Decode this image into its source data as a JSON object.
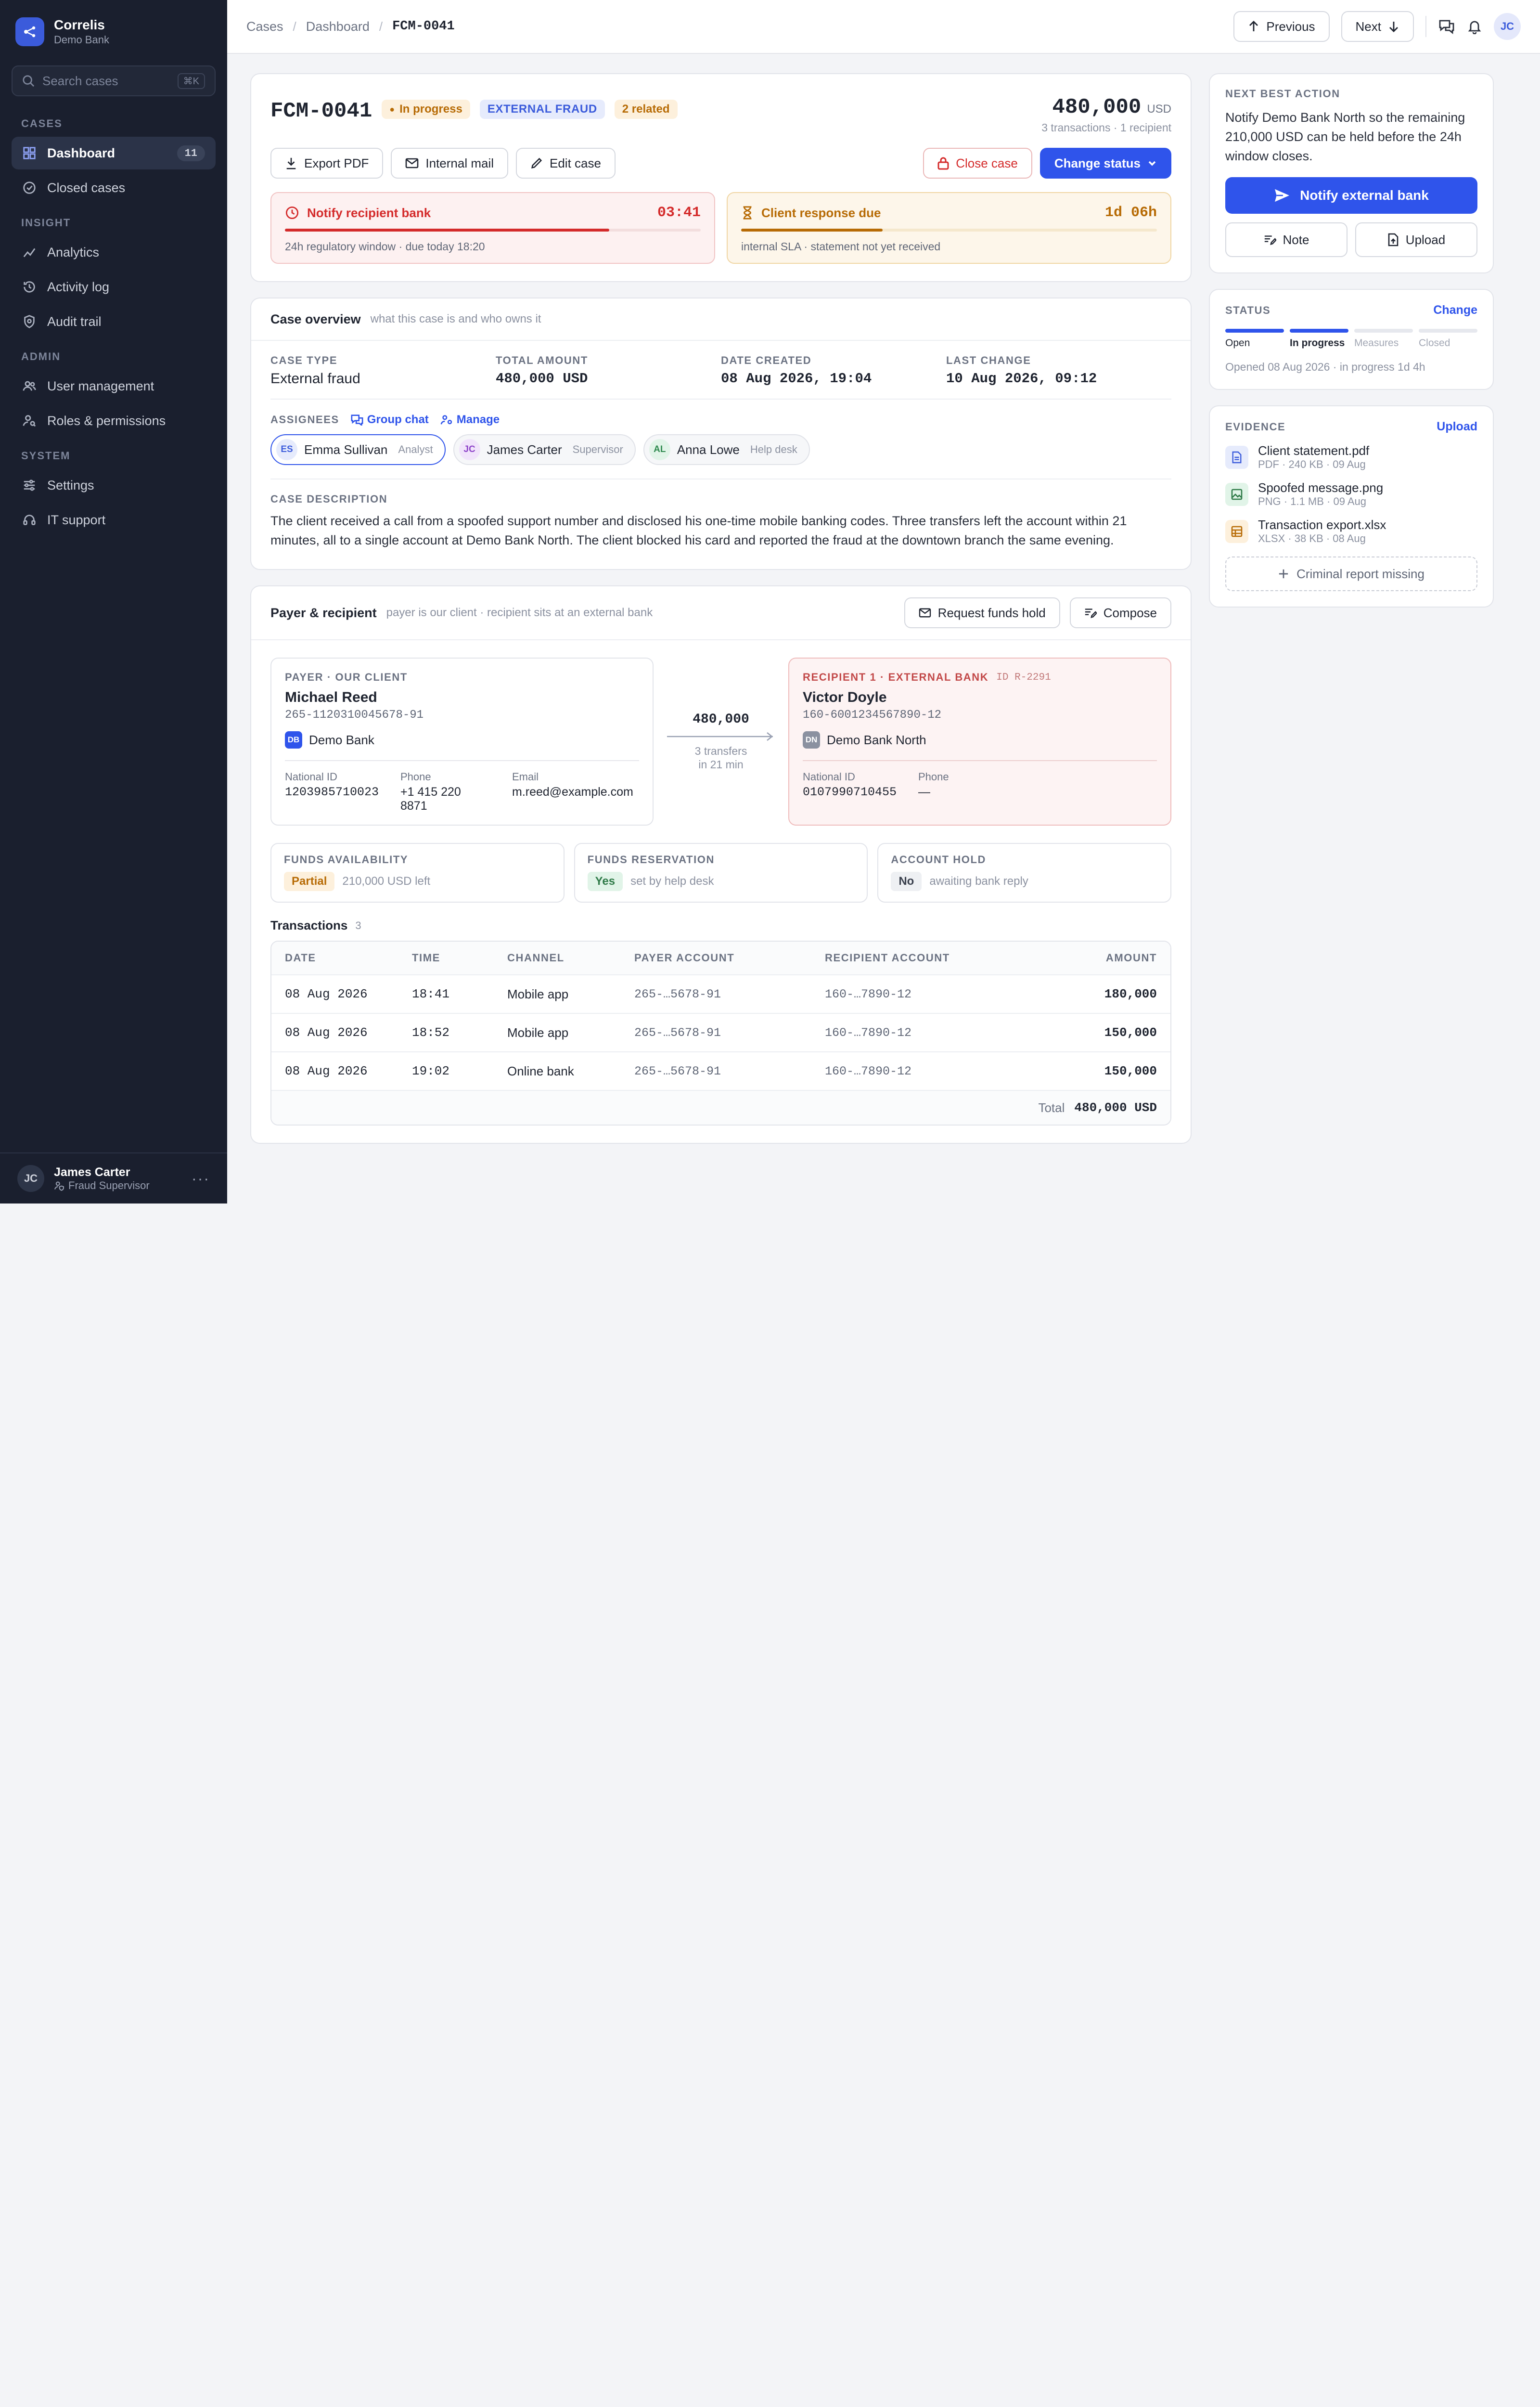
{
  "brand": {
    "name": "Correlis",
    "sub": "Demo Bank"
  },
  "search": {
    "placeholder": "Search cases",
    "shortcut": "⌘K"
  },
  "nav": {
    "cases_label": "CASES",
    "dashboard": "Dashboard",
    "dashboard_count": "11",
    "closed": "Closed cases",
    "insight_label": "INSIGHT",
    "analytics": "Analytics",
    "activity": "Activity log",
    "audit": "Audit trail",
    "admin_label": "ADMIN",
    "users": "User management",
    "roles": "Roles & permissions",
    "system_label": "SYSTEM",
    "settings": "Settings",
    "support": "IT support"
  },
  "user": {
    "initials": "JC",
    "name": "James Carter",
    "role": "Fraud Supervisor"
  },
  "breadcrumb": {
    "root": "Cases",
    "mid": "Dashboard",
    "current": "FCM-0041"
  },
  "topbar": {
    "previous": "Previous",
    "next": "Next",
    "avatar": "JC"
  },
  "case": {
    "id": "FCM-0041",
    "status_pill": "In progress",
    "type_pill": "EXTERNAL FRAUD",
    "related_pill": "2 related",
    "amount": "480,000",
    "currency": "USD",
    "amount_sub": "3 transactions · 1 recipient"
  },
  "actions": {
    "export": "Export PDF",
    "mail": "Internal mail",
    "edit": "Edit case",
    "close": "Close case",
    "change": "Change status"
  },
  "sla": {
    "red": {
      "title": "Notify recipient bank",
      "timer": "03:41",
      "progress": 0.78,
      "sub": "24h regulatory window · due today 18:20"
    },
    "amber": {
      "title": "Client response due",
      "timer": "1d 06h",
      "progress": 0.34,
      "sub": "internal SLA · statement not yet received"
    }
  },
  "overview": {
    "title": "Case overview",
    "sub": "what this case is and who owns it",
    "type_label": "CASE TYPE",
    "type": "External fraud",
    "total_label": "TOTAL AMOUNT",
    "total": "480,000 USD",
    "created_label": "DATE CREATED",
    "created": "08 Aug 2026, 19:04",
    "changed_label": "LAST CHANGE",
    "changed": "10 Aug 2026, 09:12",
    "assignees_label": "ASSIGNEES",
    "group_chat": "Group chat",
    "manage": "Manage",
    "assignees": [
      {
        "initials": "ES",
        "name": "Emma Sullivan",
        "role": "Analyst"
      },
      {
        "initials": "JC",
        "name": "James Carter",
        "role": "Supervisor"
      },
      {
        "initials": "AL",
        "name": "Anna Lowe",
        "role": "Help desk"
      }
    ],
    "desc_label": "CASE DESCRIPTION",
    "description": "The client received a call from a spoofed support number and disclosed his one-time mobile banking codes. Three transfers left the account within 21 minutes, all to a single account at Demo Bank North. The client blocked his card and reported the fraud at the downtown branch the same evening."
  },
  "payer_section": {
    "title": "Payer & recipient",
    "sub": "payer is our client · recipient sits at an external bank",
    "request_hold": "Request funds hold",
    "compose": "Compose"
  },
  "payer": {
    "label": "PAYER · OUR CLIENT",
    "name": "Michael Reed",
    "account": "265-1120310045678-91",
    "bank_code": "DB",
    "bank": "Demo Bank",
    "id_label": "National ID",
    "id": "1203985710023",
    "phone_label": "Phone",
    "phone": "+1 415 220 8871",
    "email_label": "Email",
    "email": "m.reed@example.com"
  },
  "flow": {
    "amount": "480,000",
    "line1": "3 transfers",
    "line2": "in 21 min"
  },
  "recipient": {
    "label": "RECIPIENT 1 · EXTERNAL BANK",
    "ref": "ID R-2291",
    "name": "Victor Doyle",
    "account": "160-6001234567890-12",
    "bank_code": "DN",
    "bank": "Demo Bank North",
    "id_label": "National ID",
    "id": "0107990710455",
    "phone_label": "Phone",
    "phone": "—"
  },
  "stats": {
    "availability": {
      "label": "FUNDS AVAILABILITY",
      "tag": "Partial",
      "note": "210,000 USD left"
    },
    "reservation": {
      "label": "FUNDS RESERVATION",
      "tag": "Yes",
      "note": "set by help desk"
    },
    "hold": {
      "label": "ACCOUNT HOLD",
      "tag": "No",
      "note": "awaiting bank reply"
    }
  },
  "transactions": {
    "title": "Transactions",
    "count": "3",
    "headers": [
      "DATE",
      "TIME",
      "CHANNEL",
      "PAYER ACCOUNT",
      "RECIPIENT ACCOUNT",
      "AMOUNT"
    ],
    "rows": [
      [
        "08 Aug 2026",
        "18:41",
        "Mobile app",
        "265-…5678-91",
        "160-…7890-12",
        "180,000"
      ],
      [
        "08 Aug 2026",
        "18:52",
        "Mobile app",
        "265-…5678-91",
        "160-…7890-12",
        "150,000"
      ],
      [
        "08 Aug 2026",
        "19:02",
        "Online bank",
        "265-…5678-91",
        "160-…7890-12",
        "150,000"
      ]
    ],
    "total_label": "Total",
    "total": "480,000 USD"
  },
  "nba": {
    "label": "NEXT BEST ACTION",
    "text": "Notify Demo Bank North so the remaining 210,000 USD can be held before the 24h window closes.",
    "button": "Notify external bank",
    "note": "Note",
    "upload": "Upload"
  },
  "status": {
    "label": "STATUS",
    "change": "Change",
    "steps": [
      "Open",
      "In progress",
      "Measures",
      "Closed"
    ],
    "meta": "Opened 08 Aug 2026 · in progress 1d 4h"
  },
  "evidence": {
    "label": "EVIDENCE",
    "upload": "Upload",
    "files": [
      {
        "name": "Client statement.pdf",
        "meta": "PDF · 240 KB · 09 Aug",
        "icon": "pdf-file-icon"
      },
      {
        "name": "Spoofed message.png",
        "meta": "PNG · 1.1 MB · 09 Aug",
        "icon": "image-file-icon"
      },
      {
        "name": "Transaction export.xlsx",
        "meta": "XLSX · 38 KB · 08 Aug",
        "icon": "spreadsheet-file-icon"
      }
    ],
    "missing": "Criminal report missing"
  },
  "colors": {
    "accent": "#2f54eb",
    "sidebar": "#1a1f2e",
    "danger": "#d42b2b",
    "warning": "#b76b05"
  }
}
